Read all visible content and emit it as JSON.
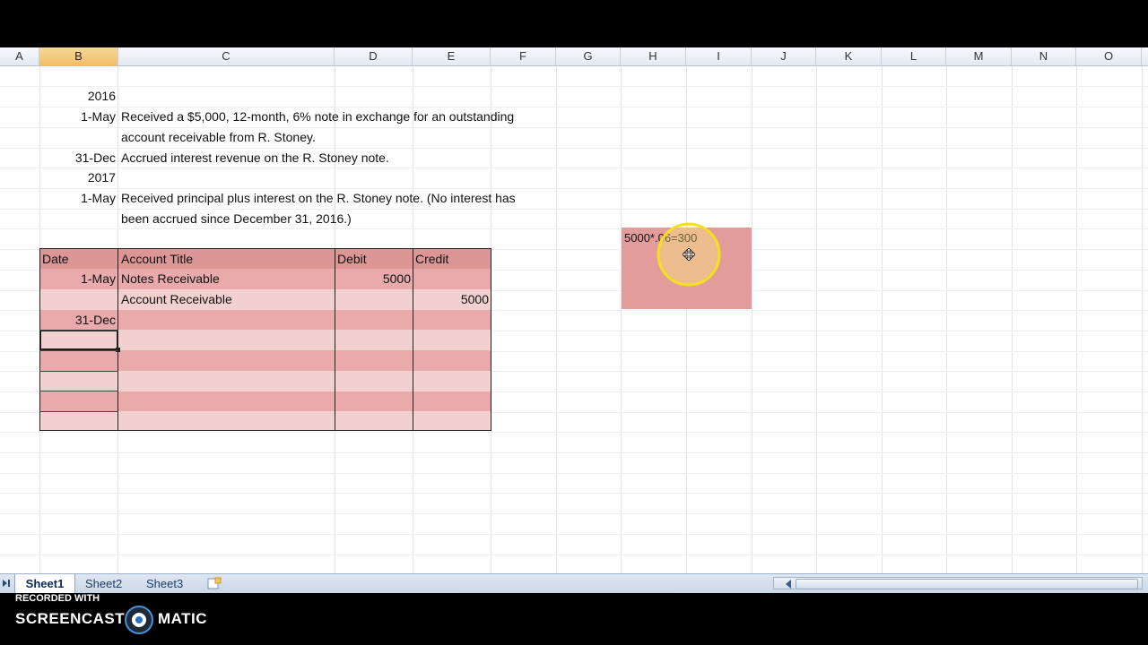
{
  "columns": [
    "A",
    "B",
    "C",
    "D",
    "E",
    "F",
    "G",
    "H",
    "I",
    "J",
    "K",
    "L",
    "M",
    "N",
    "O"
  ],
  "header_cells": {
    "year1": "2016",
    "date1": "1-May",
    "desc1_line1": "Received a $5,000, 12-month, 6% note in exchange for an outstanding",
    "desc1_line2": "account receivable from R. Stoney.",
    "date2": "31-Dec",
    "desc2": "Accrued interest revenue on the R. Stoney note.",
    "year2": "2017",
    "date3": "1-May",
    "desc3_line1": "Received principal plus interest on the R. Stoney note. (No interest has",
    "desc3_line2": "been accrued since December 31, 2016.)"
  },
  "journal": {
    "headers": [
      "Date",
      "Account Title",
      "Debit",
      "Credit"
    ],
    "rows": [
      {
        "date": "1-May",
        "account": "Notes Receivable",
        "debit": "5000",
        "credit": ""
      },
      {
        "date": "",
        "account": "Account Receivable",
        "debit": "",
        "credit": "5000"
      },
      {
        "date": "31-Dec",
        "account": "",
        "debit": "",
        "credit": ""
      },
      {
        "date": "",
        "account": "",
        "debit": "",
        "credit": ""
      },
      {
        "date": "",
        "account": "",
        "debit": "",
        "credit": ""
      },
      {
        "date": "",
        "account": "",
        "debit": "",
        "credit": ""
      },
      {
        "date": "",
        "account": "",
        "debit": "",
        "credit": ""
      },
      {
        "date": "",
        "account": "",
        "debit": "",
        "credit": ""
      }
    ]
  },
  "calc_cell": "5000*.06=300",
  "sheets": [
    "Sheet1",
    "Sheet2",
    "Sheet3"
  ],
  "active_sheet": "Sheet1",
  "watermark": {
    "small": "RECORDED WITH",
    "brand_left": "SCREENCAST",
    "brand_right": "MATIC"
  },
  "colors": {
    "header_row": "#dd9696",
    "row_dark": "#e8aaaa",
    "row_light": "#f2d0d0",
    "calc_bg": "#e39c9c"
  }
}
